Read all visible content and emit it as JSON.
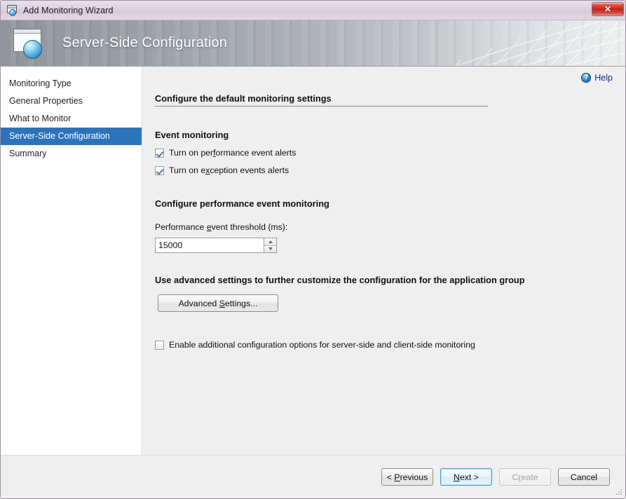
{
  "titlebar": {
    "title": "Add Monitoring Wizard",
    "icon": "wizard-window-icon",
    "close_label": "✕"
  },
  "banner": {
    "title": "Server-Side Configuration",
    "icon": "server-window-globe-icon"
  },
  "sidebar": {
    "items": [
      {
        "label": "Monitoring Type",
        "selected": false
      },
      {
        "label": "General Properties",
        "selected": false
      },
      {
        "label": "What to Monitor",
        "selected": false
      },
      {
        "label": "Server-Side Configuration",
        "selected": true
      },
      {
        "label": "Summary",
        "selected": false
      }
    ]
  },
  "help": {
    "label": "Help",
    "icon": "help-question-icon",
    "glyph": "?"
  },
  "main": {
    "section_title": "Configure the default monitoring settings",
    "event_monitoring": {
      "group_title": "Event monitoring",
      "checkboxes": [
        {
          "label_pre": "Turn on per",
          "accel": "f",
          "label_post": "ormance event alerts",
          "checked": true
        },
        {
          "label_pre": "Turn on e",
          "accel": "x",
          "label_post": "ception events alerts",
          "checked": true
        }
      ]
    },
    "performance": {
      "group_title": "Configure performance event monitoring",
      "field_label_pre": "Performance ",
      "field_label_accel": "e",
      "field_label_post": "vent threshold (ms):",
      "threshold_value": "15000",
      "threshold_placeholder": "",
      "spin_up": "▲",
      "spin_down": "▼"
    },
    "advanced": {
      "group_title": "Use advanced settings to further customize the configuration for the application group",
      "button_label_pre": "Advanced ",
      "button_label_accel": "S",
      "button_label_post": "ettings..."
    },
    "additional_options": {
      "label": "Enable additional configuration options for server-side and client-side monitoring",
      "checked": false
    }
  },
  "footer": {
    "buttons": [
      {
        "name": "previous",
        "label_pre": "< ",
        "accel": "P",
        "label_post": "revious",
        "state": "normal"
      },
      {
        "name": "next",
        "label_pre": "",
        "accel": "N",
        "label_post": "ext >",
        "state": "default"
      },
      {
        "name": "create",
        "label_pre": "C",
        "accel": "r",
        "label_post": "eate",
        "state": "disabled"
      },
      {
        "name": "cancel",
        "label_pre": "Cancel",
        "accel": "",
        "label_post": "",
        "state": "normal"
      }
    ]
  },
  "colors": {
    "selection_blue": "#2b74bb",
    "link_blue": "#10328c",
    "close_red": "#c2241b",
    "titlebar_mauve": "#ded0de",
    "content_grey": "#efefef"
  }
}
